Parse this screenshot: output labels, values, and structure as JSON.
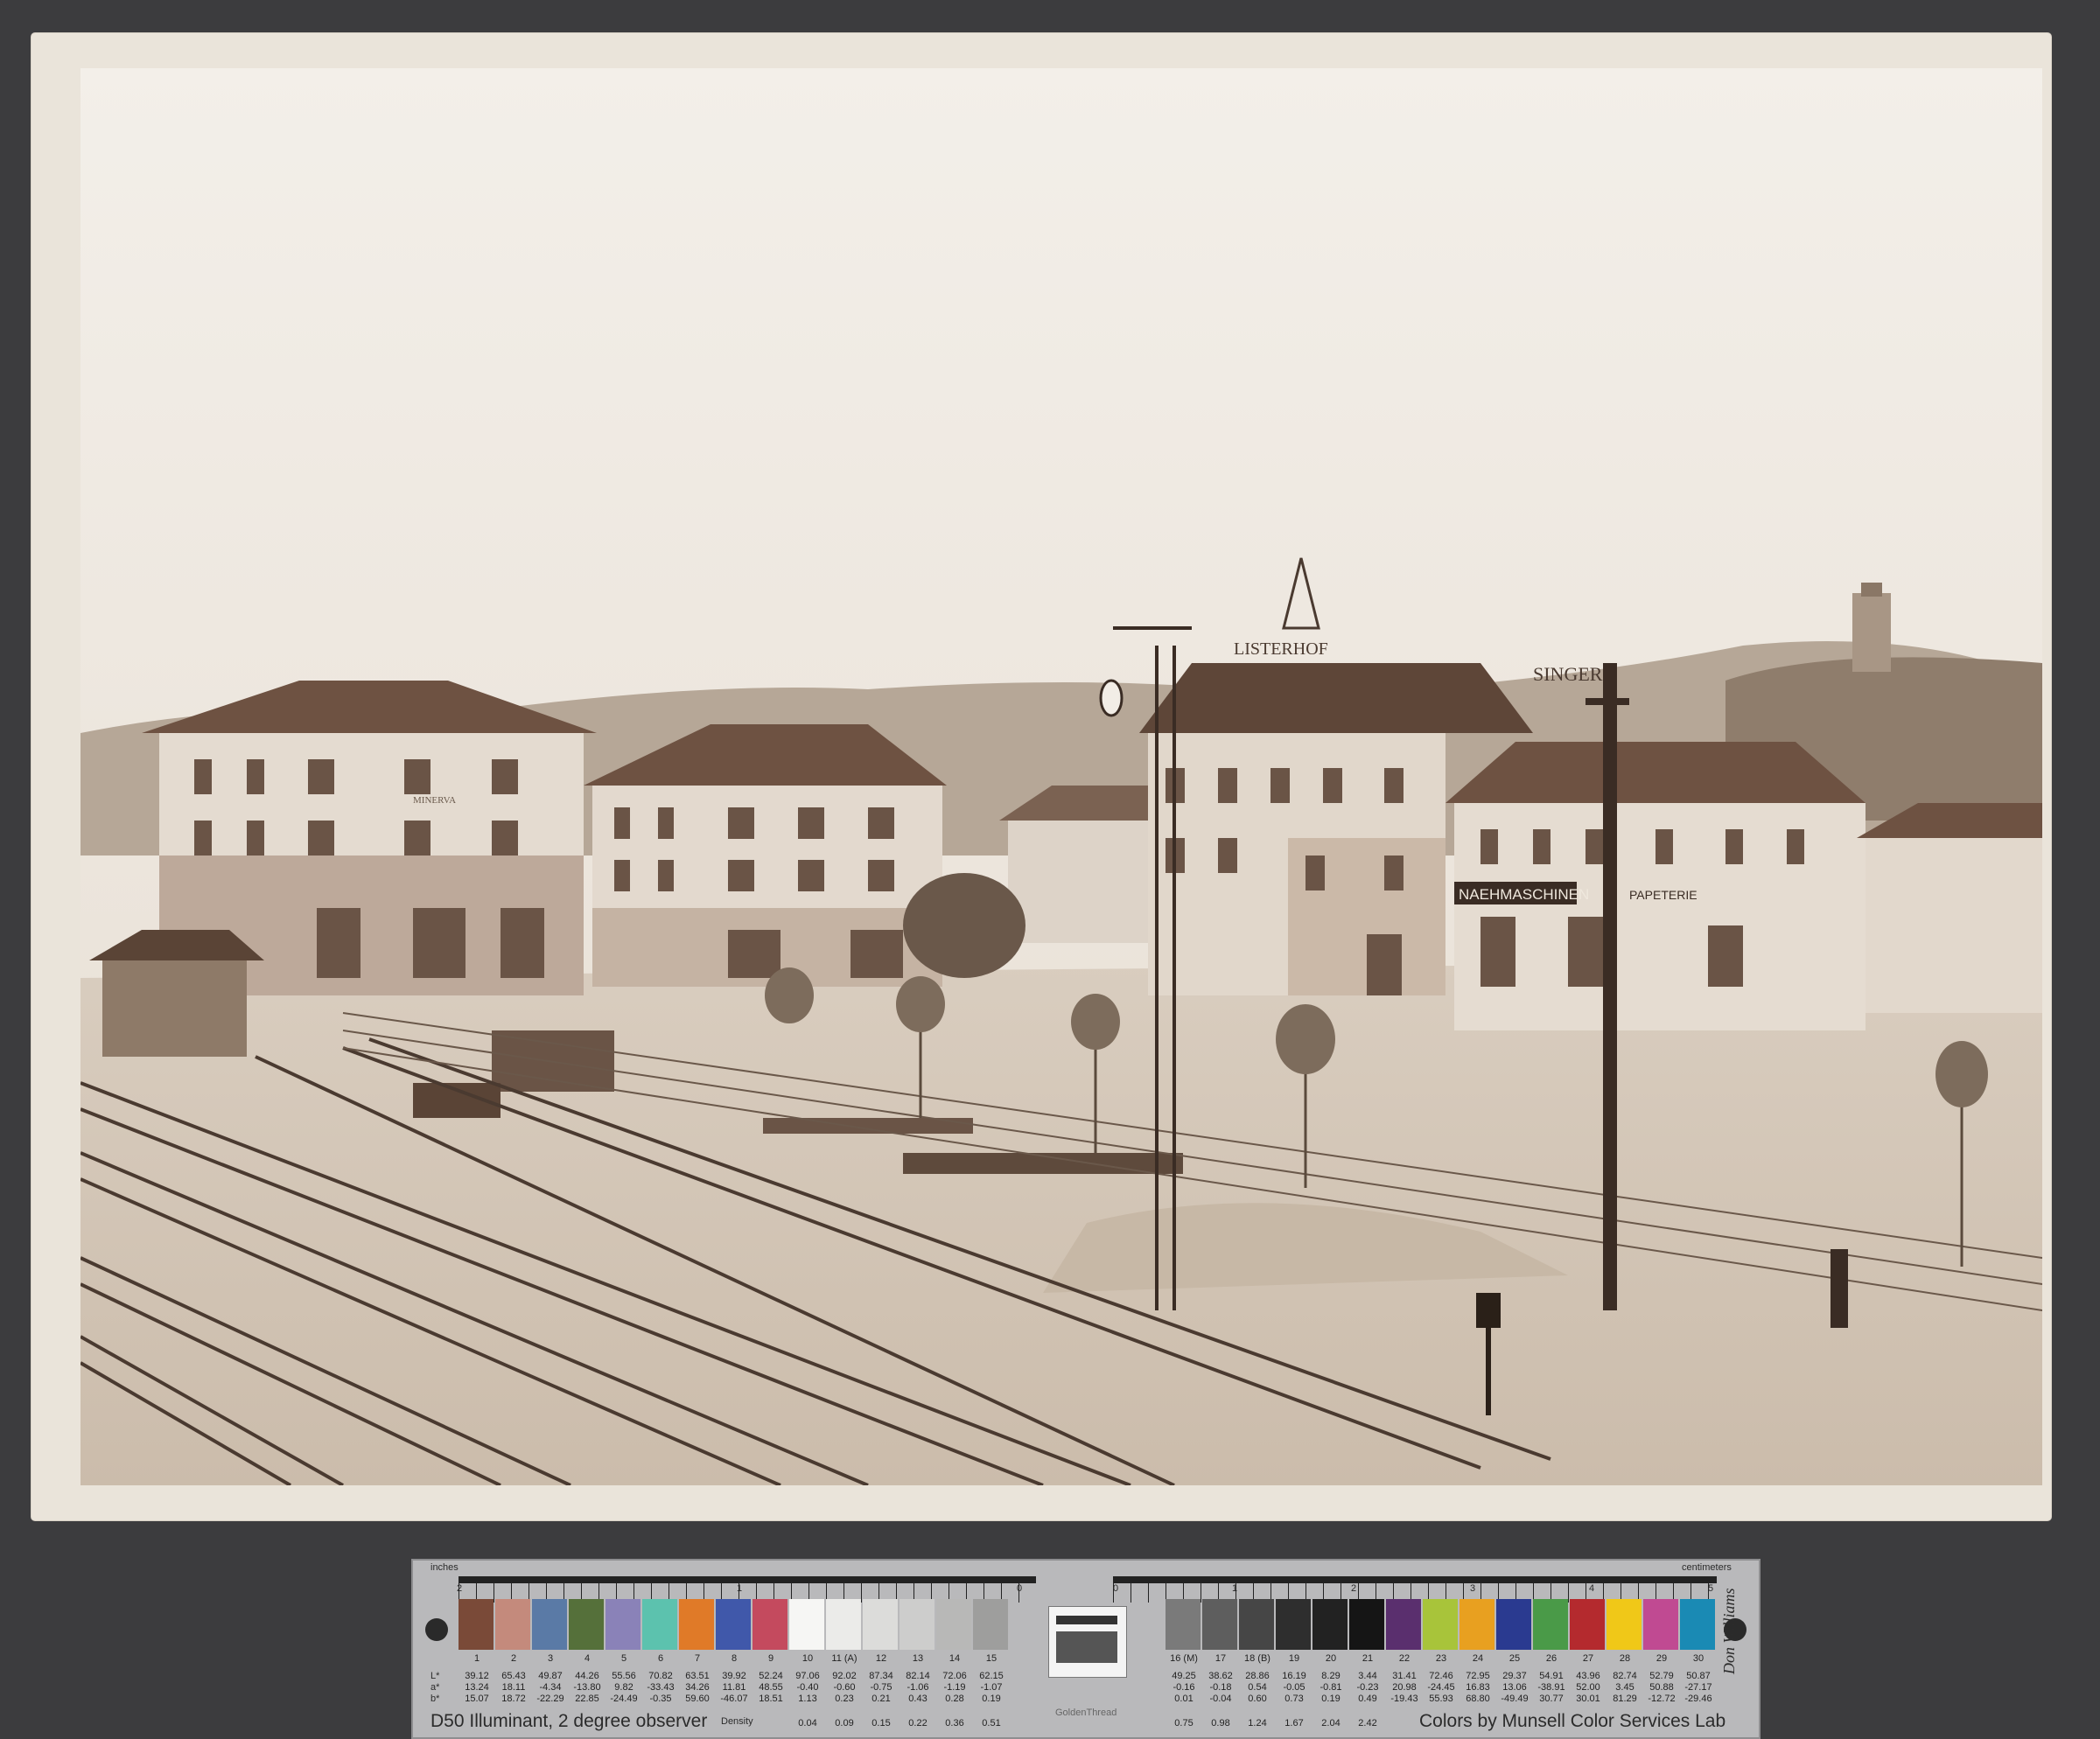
{
  "photo": {
    "signs": {
      "hotel_roof": "LISTERHOF",
      "singer": "SINGER",
      "minerva": "MINERVA",
      "naehmaschinen": "NAEHMASCHINEN",
      "papeterie": "PAPETERIE"
    }
  },
  "target": {
    "ruler_left": "inches",
    "ruler_right": "centimeters",
    "illuminant": "D50 Illuminant, 2 degree observer",
    "density_label": "Density",
    "credit": "Colors by Munsell Color Services Lab",
    "brand": "GoldenThread",
    "signature": "Don Williams",
    "row_labels": [
      "L*",
      "a*",
      "b*"
    ],
    "patches_left": [
      {
        "num": "1",
        "color": "#7a4a38",
        "L": "39.12",
        "a": "13.24",
        "b": "15.07"
      },
      {
        "num": "2",
        "color": "#c48a7c",
        "L": "65.43",
        "a": "18.11",
        "b": "18.72"
      },
      {
        "num": "3",
        "color": "#5a7aa6",
        "L": "49.87",
        "a": "-4.34",
        "b": "-22.29"
      },
      {
        "num": "4",
        "color": "#55703a",
        "L": "44.26",
        "a": "-13.80",
        "b": "22.85"
      },
      {
        "num": "5",
        "color": "#8a82b8",
        "L": "55.56",
        "a": "9.82",
        "b": "-24.49"
      },
      {
        "num": "6",
        "color": "#5cc2ae",
        "L": "70.82",
        "a": "-33.43",
        "b": "-0.35"
      },
      {
        "num": "7",
        "color": "#e07a28",
        "L": "63.51",
        "a": "34.26",
        "b": "59.60"
      },
      {
        "num": "8",
        "color": "#4058aa",
        "L": "39.92",
        "a": "11.81",
        "b": "-46.07"
      },
      {
        "num": "9",
        "color": "#c44a5e",
        "L": "52.24",
        "a": "48.55",
        "b": "18.51"
      },
      {
        "num": "10",
        "color": "#f6f6f4",
        "L": "97.06",
        "a": "-0.40",
        "b": "1.13"
      },
      {
        "num": "11 (A)",
        "color": "#ebebe9",
        "L": "92.02",
        "a": "-0.60",
        "b": "0.23"
      },
      {
        "num": "12",
        "color": "#dcdcda",
        "L": "87.34",
        "a": "-0.75",
        "b": "0.21"
      },
      {
        "num": "13",
        "color": "#cdcdcc",
        "L": "82.14",
        "a": "-1.06",
        "b": "0.43"
      },
      {
        "num": "14",
        "color": "#b8b8b7",
        "L": "72.06",
        "a": "-1.19",
        "b": "0.28"
      },
      {
        "num": "15",
        "color": "#9e9e9d",
        "L": "62.15",
        "a": "-1.07",
        "b": "0.19"
      }
    ],
    "patches_right": [
      {
        "num": "16 (M)",
        "color": "#7a7a7a",
        "L": "49.25",
        "a": "-0.16",
        "b": "0.01"
      },
      {
        "num": "17",
        "color": "#5e5e5e",
        "L": "38.62",
        "a": "-0.18",
        "b": "-0.04"
      },
      {
        "num": "18 (B)",
        "color": "#464646",
        "L": "28.86",
        "a": "0.54",
        "b": "0.60"
      },
      {
        "num": "19",
        "color": "#2e2e2e",
        "L": "16.19",
        "a": "-0.05",
        "b": "0.73"
      },
      {
        "num": "20",
        "color": "#222222",
        "L": "8.29",
        "a": "-0.81",
        "b": "0.19"
      },
      {
        "num": "21",
        "color": "#151515",
        "L": "3.44",
        "a": "-0.23",
        "b": "0.49"
      },
      {
        "num": "22",
        "color": "#5a2f6e",
        "L": "31.41",
        "a": "20.98",
        "b": "-19.43"
      },
      {
        "num": "23",
        "color": "#a8c43a",
        "L": "72.46",
        "a": "-24.45",
        "b": "55.93"
      },
      {
        "num": "24",
        "color": "#e8a020",
        "L": "72.95",
        "a": "16.83",
        "b": "68.80"
      },
      {
        "num": "25",
        "color": "#2a3a90",
        "L": "29.37",
        "a": "13.06",
        "b": "-49.49"
      },
      {
        "num": "26",
        "color": "#4a9a48",
        "L": "54.91",
        "a": "-38.91",
        "b": "30.77"
      },
      {
        "num": "27",
        "color": "#b42a2e",
        "L": "43.96",
        "a": "52.00",
        "b": "30.01"
      },
      {
        "num": "28",
        "color": "#f0c818",
        "L": "82.74",
        "a": "3.45",
        "b": "81.29"
      },
      {
        "num": "29",
        "color": "#c04a92",
        "L": "52.79",
        "a": "50.88",
        "b": "-12.72"
      },
      {
        "num": "30",
        "color": "#1a8ab4",
        "L": "50.87",
        "a": "-27.17",
        "b": "-29.46"
      }
    ],
    "density_left": [
      "0.04",
      "0.09",
      "0.15",
      "0.22",
      "0.36",
      "0.51"
    ],
    "density_right": [
      "0.75",
      "0.98",
      "1.24",
      "1.67",
      "2.04",
      "2.42"
    ],
    "inch_marks": [
      "2",
      "1",
      "0"
    ],
    "cm_marks": [
      "0",
      "1",
      "2",
      "3",
      "4",
      "5"
    ]
  }
}
